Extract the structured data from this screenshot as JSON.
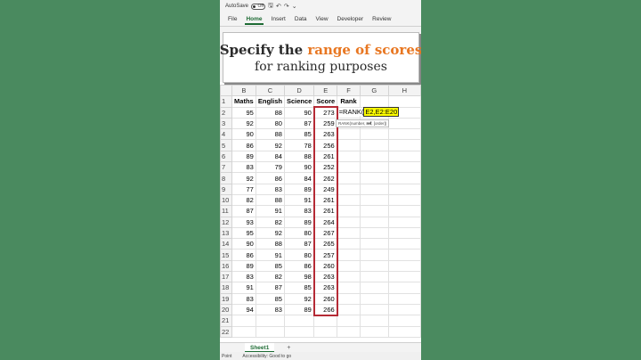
{
  "titlebar": {
    "autosave_label": "AutoSave",
    "toggle_state": "Off"
  },
  "ribbon": {
    "tabs": [
      "File",
      "Home",
      "Insert",
      "Data",
      "View",
      "Developer",
      "Review"
    ],
    "active_tab": "Home"
  },
  "banner": {
    "line1_pre": "Specify the ",
    "line1_highlight": "range of scores",
    "line2": "for ranking purposes"
  },
  "sheet": {
    "columns": [
      "B",
      "C",
      "D",
      "E",
      "F",
      "G",
      "H"
    ],
    "headers": [
      "Maths",
      "English",
      "Science",
      "Score",
      "Rank"
    ],
    "rows": [
      [
        "95",
        "88",
        "90",
        "273"
      ],
      [
        "92",
        "80",
        "87",
        "259"
      ],
      [
        "90",
        "88",
        "85",
        "263"
      ],
      [
        "86",
        "92",
        "78",
        "256"
      ],
      [
        "89",
        "84",
        "88",
        "261"
      ],
      [
        "83",
        "79",
        "90",
        "252"
      ],
      [
        "92",
        "86",
        "84",
        "262"
      ],
      [
        "77",
        "83",
        "89",
        "249"
      ],
      [
        "82",
        "88",
        "91",
        "261"
      ],
      [
        "87",
        "91",
        "83",
        "261"
      ],
      [
        "93",
        "82",
        "89",
        "264"
      ],
      [
        "95",
        "92",
        "80",
        "267"
      ],
      [
        "90",
        "88",
        "87",
        "265"
      ],
      [
        "86",
        "91",
        "80",
        "257"
      ],
      [
        "89",
        "85",
        "86",
        "260"
      ],
      [
        "83",
        "82",
        "98",
        "263"
      ],
      [
        "91",
        "87",
        "85",
        "263"
      ],
      [
        "83",
        "85",
        "92",
        "260"
      ],
      [
        "94",
        "83",
        "89",
        "266"
      ]
    ],
    "row_numbers": [
      "1",
      "2",
      "3",
      "4",
      "5",
      "6",
      "7",
      "8",
      "9",
      "10",
      "11",
      "12",
      "13",
      "14",
      "15",
      "16",
      "17",
      "18",
      "19",
      "20",
      "21",
      "22"
    ],
    "formula_prefix": "=RANK(",
    "formula_range": "E2,E2:E20",
    "tooltip_prefix": "RANK(number, ",
    "tooltip_bold": "ref",
    "tooltip_suffix": ", [order])"
  },
  "sheet_tabs": {
    "active": "Sheet1",
    "add": "+"
  },
  "status": {
    "mode": "Point",
    "accessibility": "Accessibility: Good to go"
  }
}
